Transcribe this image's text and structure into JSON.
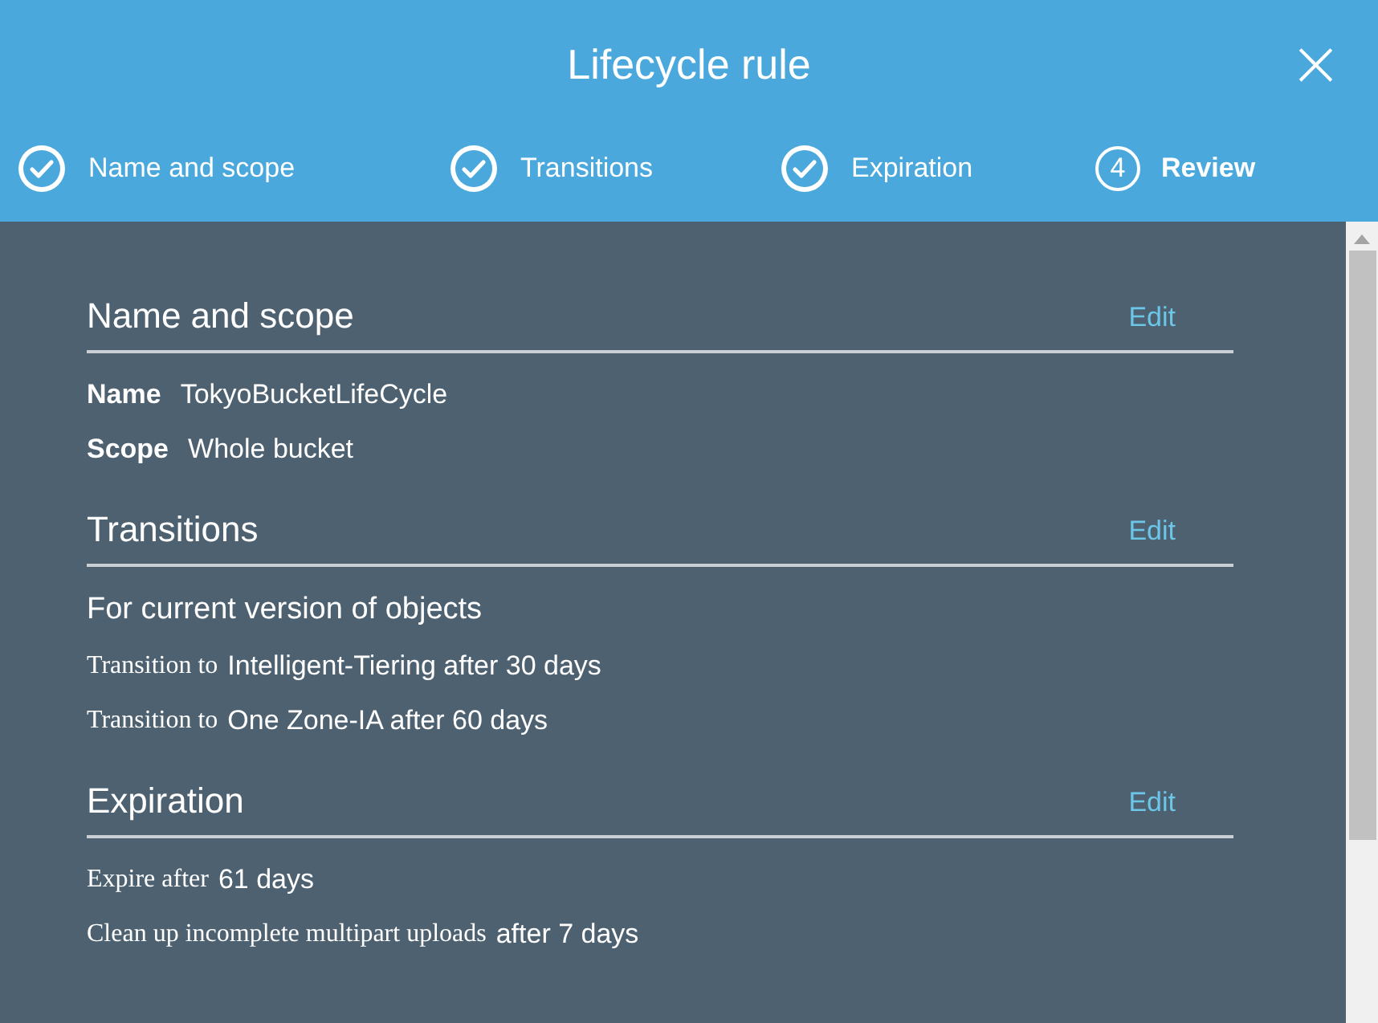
{
  "dialog": {
    "title": "Lifecycle rule",
    "close": "×"
  },
  "steps": [
    {
      "label": "Name and scope",
      "completed": true,
      "selected": false
    },
    {
      "label": "Transitions",
      "completed": true,
      "selected": false
    },
    {
      "label": "Expiration",
      "completed": true,
      "selected": false
    },
    {
      "label": "Review",
      "number": "4",
      "completed": false,
      "selected": true
    }
  ],
  "sections": [
    {
      "title": "Name and scope",
      "edit": "Edit",
      "rows": [
        {
          "kind": "field",
          "label": "Name",
          "value": "TokyoBucketLifeCycle"
        },
        {
          "kind": "field",
          "label": "Scope",
          "value": "Whole bucket"
        }
      ]
    },
    {
      "title": "Transitions",
      "edit": "Edit",
      "rows": [
        {
          "kind": "subheading",
          "value": "For current version of objects"
        },
        {
          "kind": "rule",
          "label": "Transition to",
          "value": "Intelligent-Tiering after 30 days"
        },
        {
          "kind": "rule",
          "label": "Transition to",
          "value": "One Zone-IA after 60 days"
        }
      ]
    },
    {
      "title": "Expiration",
      "edit": "Edit",
      "rows": [
        {
          "kind": "rule",
          "label": "Expire after",
          "value": "61 days"
        },
        {
          "kind": "rule",
          "label": "Clean up incomplete multipart uploads",
          "value": "after 7 days"
        }
      ]
    }
  ]
}
